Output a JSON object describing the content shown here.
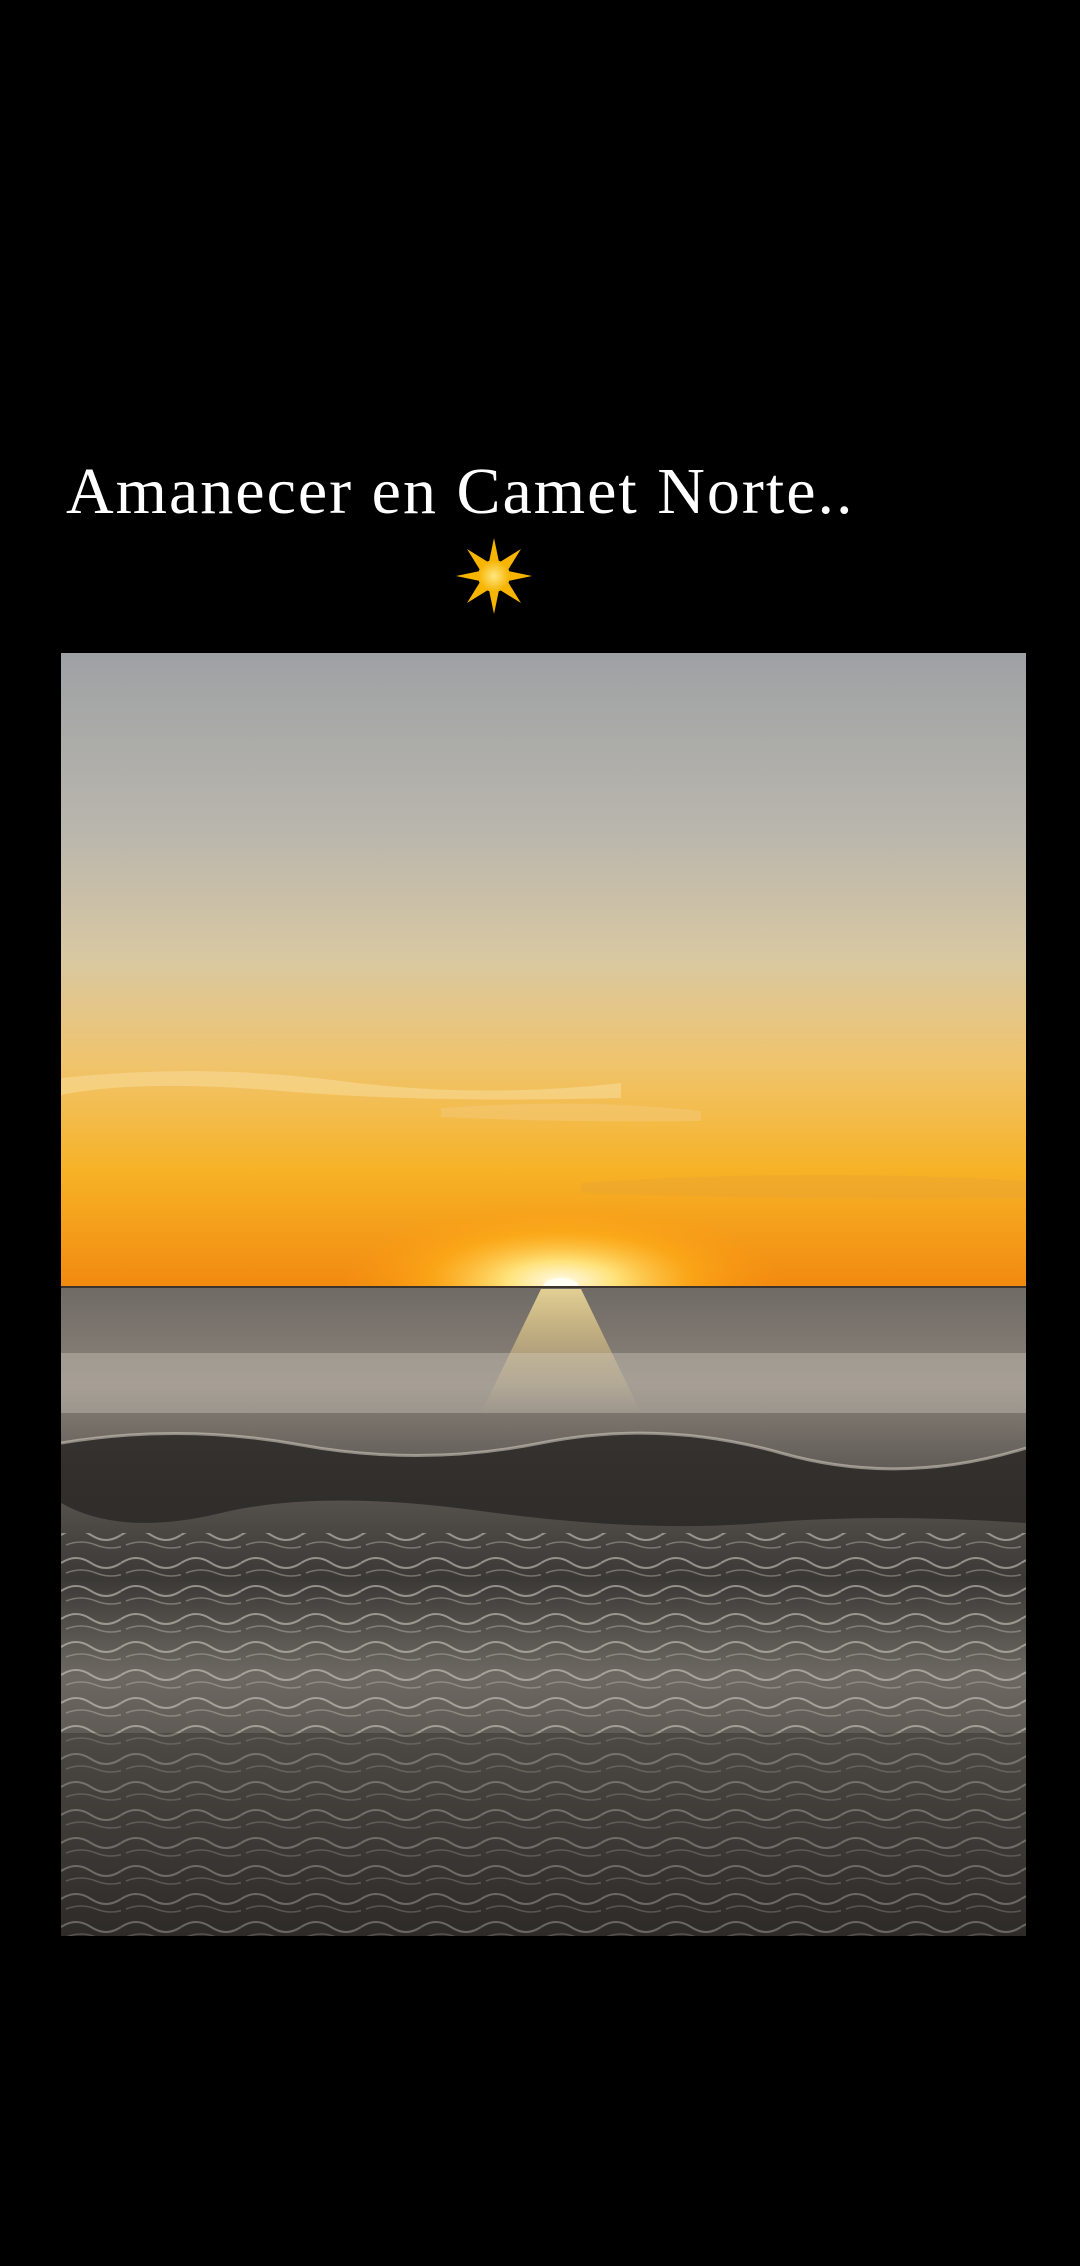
{
  "story": {
    "caption": "Amanecer en Camet Norte..",
    "caption_color": "#ffffff",
    "background_color": "#000000",
    "sticker": {
      "icon": "sun-icon",
      "glyph": "☀",
      "color": "#f7b500"
    },
    "photo": {
      "subject": "sunrise over the sea",
      "sky_colors": [
        "#9ea1a4",
        "#c9c3b4",
        "#f2c05a",
        "#f59a13"
      ],
      "sea_colors": [
        "#6d6860",
        "#4a4744",
        "#2d2a28"
      ]
    }
  }
}
